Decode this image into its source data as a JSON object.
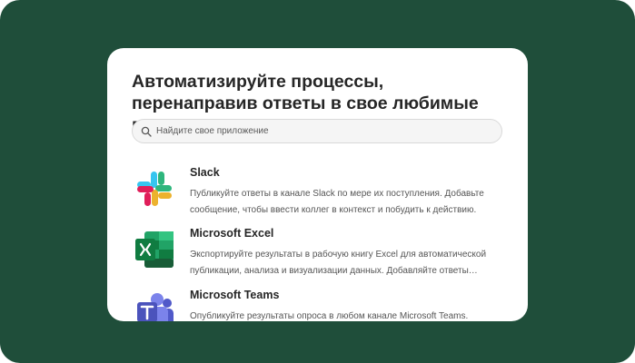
{
  "colors": {
    "background": "#1f4e3a",
    "card": "#ffffff",
    "title": "#262626",
    "text": "#555555"
  },
  "card": {
    "title": "Автоматизируйте процессы, перенаправив ответы в свое любимые приложения"
  },
  "search": {
    "placeholder": "Найдите свое приложение",
    "value": ""
  },
  "apps": [
    {
      "name": "Slack",
      "icon": "slack-icon",
      "description": "Публикуйте ответы в канале Slack по мере их поступления. Добавьте сообщение, чтобы ввести коллег в контекст и побудить к действию."
    },
    {
      "name": "Microsoft Excel",
      "icon": "excel-icon",
      "description": "Экспортируйте результаты в рабочую книгу Excel для автоматической публикации, анализа и визуализации данных. Добавляйте ответы мгновенно."
    },
    {
      "name": "Microsoft Teams",
      "icon": "teams-icon",
      "description": "Опубликуйте результаты опроса в любом канале Microsoft Teams."
    }
  ]
}
